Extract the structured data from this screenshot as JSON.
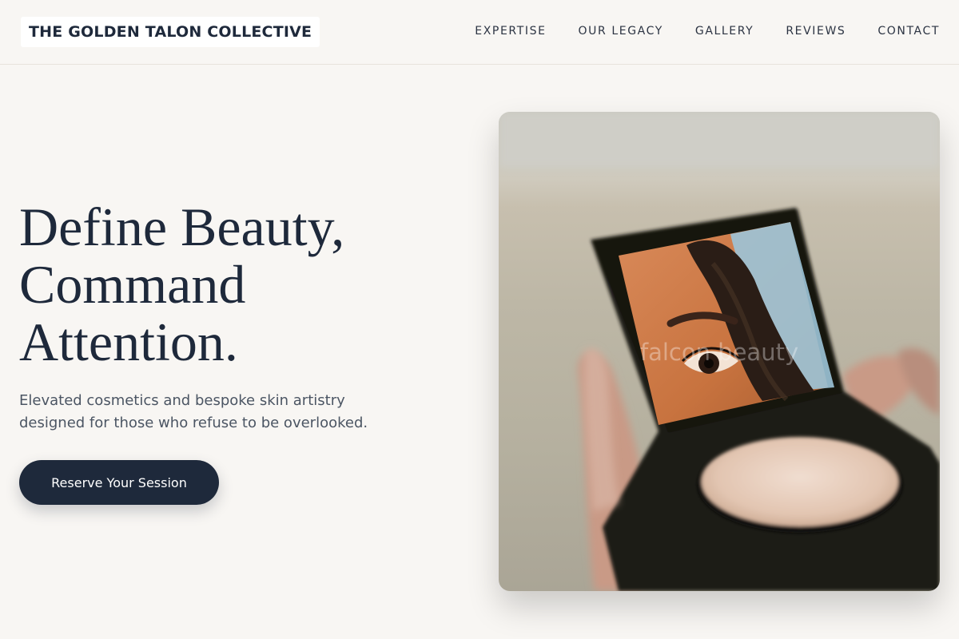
{
  "brand": {
    "name": "THE GOLDEN TALON COLLECTIVE"
  },
  "nav": {
    "items": [
      "EXPERTISE",
      "OUR LEGACY",
      "GALLERY",
      "REVIEWS",
      "CONTACT"
    ]
  },
  "hero": {
    "title_lines": [
      "Define Beauty,",
      "Command",
      "Attention."
    ],
    "subtitle_lines": [
      "Elevated cosmetics and bespoke skin artistry",
      "designed for those who refuse to be overlooked."
    ],
    "cta_label": "Reserve Your Session"
  },
  "photo": {
    "watermark": "falcon beauty",
    "subject": "hand holding compact mirror reflecting an eye"
  },
  "colors": {
    "background": "#f8f6f3",
    "primary": "#1e293b",
    "text_muted": "#4b5563"
  }
}
